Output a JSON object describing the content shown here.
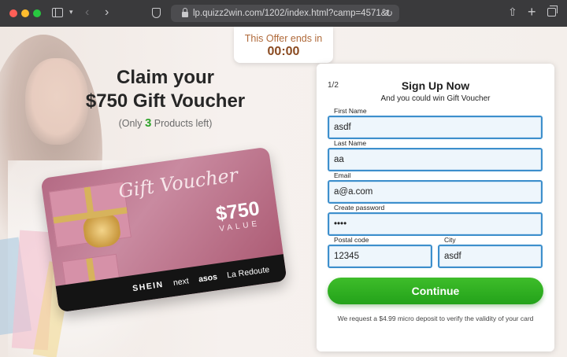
{
  "browser": {
    "url": "lp.quizz2win.com/1202/index.html?camp=4571&theme=13",
    "icons": [
      "sidebar-icon",
      "chevron-down-icon",
      "back-icon",
      "forward-icon",
      "shield-icon",
      "lock-icon",
      "reload-icon",
      "share-icon",
      "new-tab-icon",
      "tabs-overview-icon"
    ]
  },
  "timer": {
    "label": "This Offer ends in",
    "time": "00:00"
  },
  "hero": {
    "headline_line1": "Claim your",
    "headline_line2": "$750 Gift Voucher",
    "sub_prefix": "(Only ",
    "sub_count": "3",
    "sub_suffix": " Products left)"
  },
  "voucher": {
    "title": "Gift Voucher",
    "amount": "$750",
    "value_label": "VALUE",
    "brands": [
      "SHEIN",
      "next",
      "asos",
      "La Redoute"
    ]
  },
  "form": {
    "step": "1/2",
    "title": "Sign Up Now",
    "subtitle": "And you could win Gift Voucher",
    "first_name_label": "First Name",
    "first_name_value": "asdf",
    "last_name_label": "Last Name",
    "last_name_value": "aa",
    "email_label": "Email",
    "email_value": "a@a.com",
    "password_label": "Create password",
    "password_value": "••••",
    "postal_label": "Postal code",
    "postal_value": "12345",
    "city_label": "City",
    "city_value": "asdf",
    "continue_label": "Continue",
    "note": "We request a $4.99 micro deposit to verify the validity of your card"
  },
  "colors": {
    "accent_green": "#2fa32b",
    "field_border": "#3d8fcc",
    "timer_text": "#b06a3a"
  }
}
